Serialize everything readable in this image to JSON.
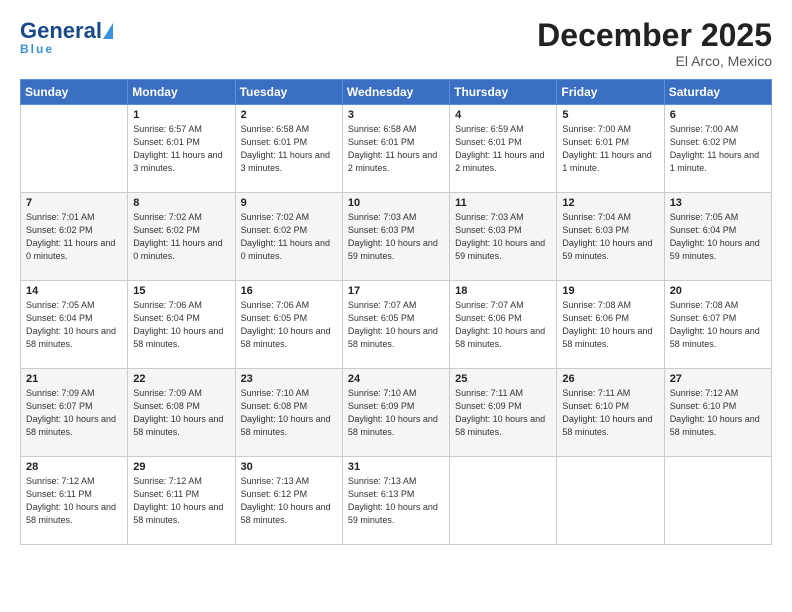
{
  "header": {
    "logo_general": "General",
    "logo_blue": "Blue",
    "month_title": "December 2025",
    "location": "El Arco, Mexico"
  },
  "days_of_week": [
    "Sunday",
    "Monday",
    "Tuesday",
    "Wednesday",
    "Thursday",
    "Friday",
    "Saturday"
  ],
  "weeks": [
    [
      {
        "day": "",
        "sunrise": "",
        "sunset": "",
        "daylight": ""
      },
      {
        "day": "1",
        "sunrise": "Sunrise: 6:57 AM",
        "sunset": "Sunset: 6:01 PM",
        "daylight": "Daylight: 11 hours and 3 minutes."
      },
      {
        "day": "2",
        "sunrise": "Sunrise: 6:58 AM",
        "sunset": "Sunset: 6:01 PM",
        "daylight": "Daylight: 11 hours and 3 minutes."
      },
      {
        "day": "3",
        "sunrise": "Sunrise: 6:58 AM",
        "sunset": "Sunset: 6:01 PM",
        "daylight": "Daylight: 11 hours and 2 minutes."
      },
      {
        "day": "4",
        "sunrise": "Sunrise: 6:59 AM",
        "sunset": "Sunset: 6:01 PM",
        "daylight": "Daylight: 11 hours and 2 minutes."
      },
      {
        "day": "5",
        "sunrise": "Sunrise: 7:00 AM",
        "sunset": "Sunset: 6:01 PM",
        "daylight": "Daylight: 11 hours and 1 minute."
      },
      {
        "day": "6",
        "sunrise": "Sunrise: 7:00 AM",
        "sunset": "Sunset: 6:02 PM",
        "daylight": "Daylight: 11 hours and 1 minute."
      }
    ],
    [
      {
        "day": "7",
        "sunrise": "Sunrise: 7:01 AM",
        "sunset": "Sunset: 6:02 PM",
        "daylight": "Daylight: 11 hours and 0 minutes."
      },
      {
        "day": "8",
        "sunrise": "Sunrise: 7:02 AM",
        "sunset": "Sunset: 6:02 PM",
        "daylight": "Daylight: 11 hours and 0 minutes."
      },
      {
        "day": "9",
        "sunrise": "Sunrise: 7:02 AM",
        "sunset": "Sunset: 6:02 PM",
        "daylight": "Daylight: 11 hours and 0 minutes."
      },
      {
        "day": "10",
        "sunrise": "Sunrise: 7:03 AM",
        "sunset": "Sunset: 6:03 PM",
        "daylight": "Daylight: 10 hours and 59 minutes."
      },
      {
        "day": "11",
        "sunrise": "Sunrise: 7:03 AM",
        "sunset": "Sunset: 6:03 PM",
        "daylight": "Daylight: 10 hours and 59 minutes."
      },
      {
        "day": "12",
        "sunrise": "Sunrise: 7:04 AM",
        "sunset": "Sunset: 6:03 PM",
        "daylight": "Daylight: 10 hours and 59 minutes."
      },
      {
        "day": "13",
        "sunrise": "Sunrise: 7:05 AM",
        "sunset": "Sunset: 6:04 PM",
        "daylight": "Daylight: 10 hours and 59 minutes."
      }
    ],
    [
      {
        "day": "14",
        "sunrise": "Sunrise: 7:05 AM",
        "sunset": "Sunset: 6:04 PM",
        "daylight": "Daylight: 10 hours and 58 minutes."
      },
      {
        "day": "15",
        "sunrise": "Sunrise: 7:06 AM",
        "sunset": "Sunset: 6:04 PM",
        "daylight": "Daylight: 10 hours and 58 minutes."
      },
      {
        "day": "16",
        "sunrise": "Sunrise: 7:06 AM",
        "sunset": "Sunset: 6:05 PM",
        "daylight": "Daylight: 10 hours and 58 minutes."
      },
      {
        "day": "17",
        "sunrise": "Sunrise: 7:07 AM",
        "sunset": "Sunset: 6:05 PM",
        "daylight": "Daylight: 10 hours and 58 minutes."
      },
      {
        "day": "18",
        "sunrise": "Sunrise: 7:07 AM",
        "sunset": "Sunset: 6:06 PM",
        "daylight": "Daylight: 10 hours and 58 minutes."
      },
      {
        "day": "19",
        "sunrise": "Sunrise: 7:08 AM",
        "sunset": "Sunset: 6:06 PM",
        "daylight": "Daylight: 10 hours and 58 minutes."
      },
      {
        "day": "20",
        "sunrise": "Sunrise: 7:08 AM",
        "sunset": "Sunset: 6:07 PM",
        "daylight": "Daylight: 10 hours and 58 minutes."
      }
    ],
    [
      {
        "day": "21",
        "sunrise": "Sunrise: 7:09 AM",
        "sunset": "Sunset: 6:07 PM",
        "daylight": "Daylight: 10 hours and 58 minutes."
      },
      {
        "day": "22",
        "sunrise": "Sunrise: 7:09 AM",
        "sunset": "Sunset: 6:08 PM",
        "daylight": "Daylight: 10 hours and 58 minutes."
      },
      {
        "day": "23",
        "sunrise": "Sunrise: 7:10 AM",
        "sunset": "Sunset: 6:08 PM",
        "daylight": "Daylight: 10 hours and 58 minutes."
      },
      {
        "day": "24",
        "sunrise": "Sunrise: 7:10 AM",
        "sunset": "Sunset: 6:09 PM",
        "daylight": "Daylight: 10 hours and 58 minutes."
      },
      {
        "day": "25",
        "sunrise": "Sunrise: 7:11 AM",
        "sunset": "Sunset: 6:09 PM",
        "daylight": "Daylight: 10 hours and 58 minutes."
      },
      {
        "day": "26",
        "sunrise": "Sunrise: 7:11 AM",
        "sunset": "Sunset: 6:10 PM",
        "daylight": "Daylight: 10 hours and 58 minutes."
      },
      {
        "day": "27",
        "sunrise": "Sunrise: 7:12 AM",
        "sunset": "Sunset: 6:10 PM",
        "daylight": "Daylight: 10 hours and 58 minutes."
      }
    ],
    [
      {
        "day": "28",
        "sunrise": "Sunrise: 7:12 AM",
        "sunset": "Sunset: 6:11 PM",
        "daylight": "Daylight: 10 hours and 58 minutes."
      },
      {
        "day": "29",
        "sunrise": "Sunrise: 7:12 AM",
        "sunset": "Sunset: 6:11 PM",
        "daylight": "Daylight: 10 hours and 58 minutes."
      },
      {
        "day": "30",
        "sunrise": "Sunrise: 7:13 AM",
        "sunset": "Sunset: 6:12 PM",
        "daylight": "Daylight: 10 hours and 58 minutes."
      },
      {
        "day": "31",
        "sunrise": "Sunrise: 7:13 AM",
        "sunset": "Sunset: 6:13 PM",
        "daylight": "Daylight: 10 hours and 59 minutes."
      },
      {
        "day": "",
        "sunrise": "",
        "sunset": "",
        "daylight": ""
      },
      {
        "day": "",
        "sunrise": "",
        "sunset": "",
        "daylight": ""
      },
      {
        "day": "",
        "sunrise": "",
        "sunset": "",
        "daylight": ""
      }
    ]
  ]
}
